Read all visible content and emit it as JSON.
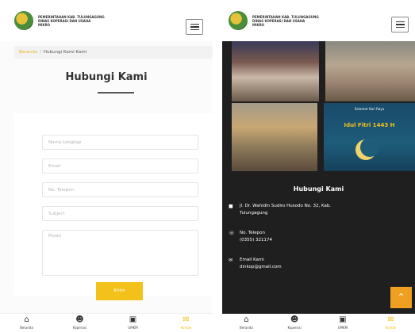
{
  "header": {
    "org_line1": "PEMERINTAHAN KAB. TULUNGAGUNG",
    "org_line2": "DINAS KOPERASI DAN USAHA",
    "org_line3": "MIKRO",
    "menu_icon": "hamburger-icon"
  },
  "breadcrumb": {
    "home": "Beranda",
    "separator": "/",
    "current": "Hubungi Kami Kami"
  },
  "page_title": "Hubungi Kami",
  "form": {
    "name_placeholder": "Nama Lengkap",
    "email_placeholder": "Email",
    "phone_placeholder": "No. Telepon",
    "subject_placeholder": "Subject",
    "message_placeholder": "Pesan",
    "submit_label": "Kirim"
  },
  "bottom_nav": [
    {
      "label": "Beranda",
      "icon": "home-icon"
    },
    {
      "label": "Koperasi",
      "icon": "users-icon"
    },
    {
      "label": "UMKM",
      "icon": "briefcase-icon"
    },
    {
      "label": "Kontak",
      "icon": "mail-icon",
      "active": true
    }
  ],
  "gallery": {
    "tile4_title_line1": "Selamat Hari Raya",
    "tile4_title_line2": "Idul Fitri 1443 H"
  },
  "contact": {
    "title": "Hubungi Kami",
    "address": "Jl. Dr. Wahidin Sudiro Husodo No. 32, Kab. Tulungagung",
    "phone_label": "No. Telepon",
    "phone_value": "(0355) 321174",
    "email_label": "Email Kami",
    "email_value": "dinkop@gmail.com"
  },
  "colors": {
    "accent": "#f3c21a",
    "dark_bg": "#1f1f1f",
    "scroll_top": "#f0a020"
  }
}
